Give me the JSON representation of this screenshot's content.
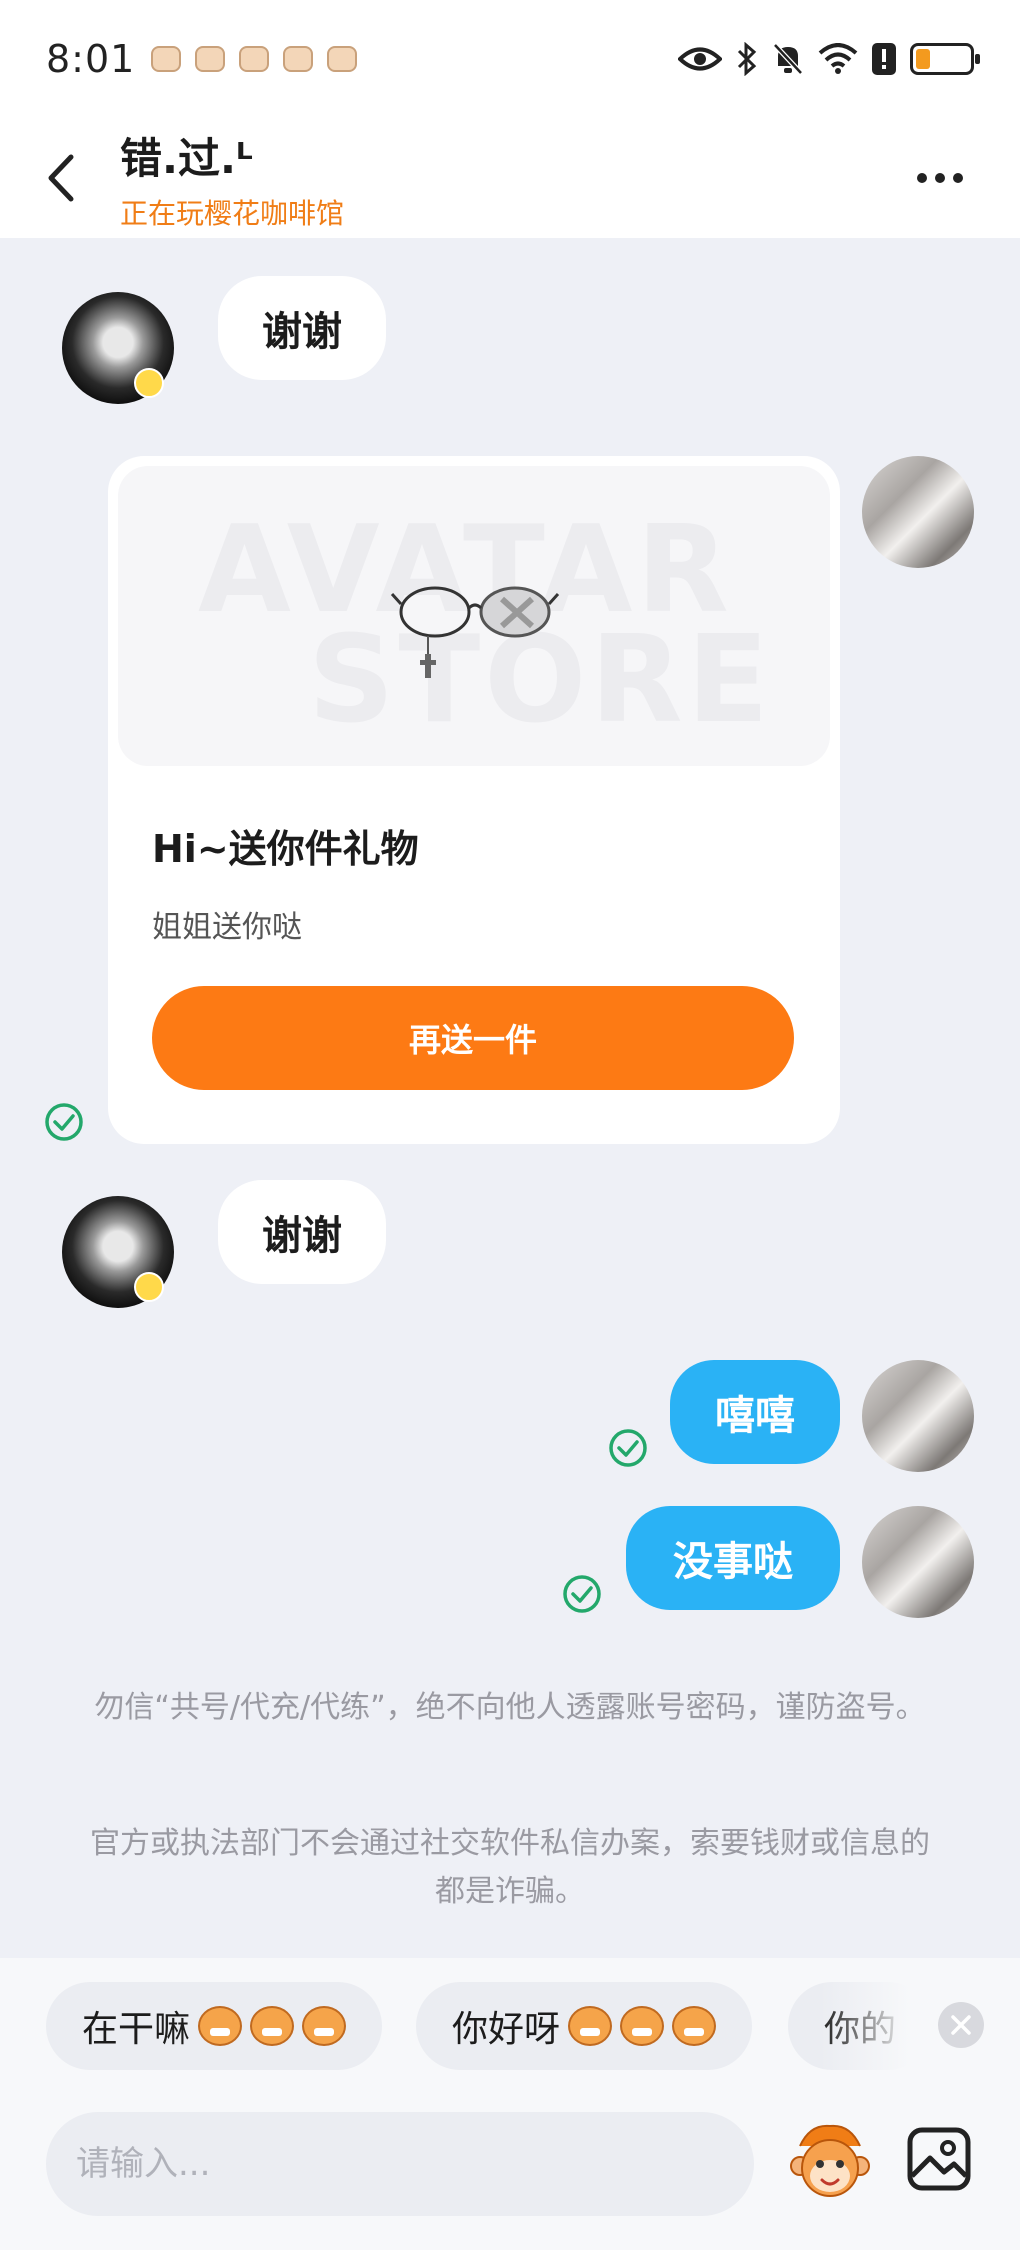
{
  "status_bar": {
    "time": "8:01"
  },
  "header": {
    "contact_name": "错.过.ᴸ",
    "contact_status": "正在玩樱花咖啡馆"
  },
  "messages": [
    {
      "side": "in",
      "text": "谢谢"
    },
    {
      "side": "out",
      "type": "gift_card",
      "watermark_line1": "AVATAR",
      "watermark_line2": "STORE",
      "title": "Hi~送你件礼物",
      "description": "姐姐送你哒",
      "button_label": "再送一件"
    },
    {
      "side": "in",
      "text": "谢谢"
    },
    {
      "side": "out",
      "text": "嘻嘻"
    },
    {
      "side": "out",
      "text": "没事哒"
    }
  ],
  "notices": [
    "勿信“共号/代充/代练”，绝不向他人透露账号密码，谨防盗号。",
    "官方或执法部门不会通过社交软件私信办案，索要钱财或信息的都是诈骗。"
  ],
  "quick_replies": [
    {
      "text": "在干嘛",
      "emoji": "grinning-monkey-icon"
    },
    {
      "text": "你好呀",
      "emoji": "monkey-face-icon"
    },
    {
      "text": "你的"
    }
  ],
  "input": {
    "placeholder": "请输入..."
  },
  "colors": {
    "accent": "#fd7a14",
    "outgoing_bubble": "#2ab2f5",
    "read_check": "#23a86b",
    "background": "#eef0f6"
  }
}
